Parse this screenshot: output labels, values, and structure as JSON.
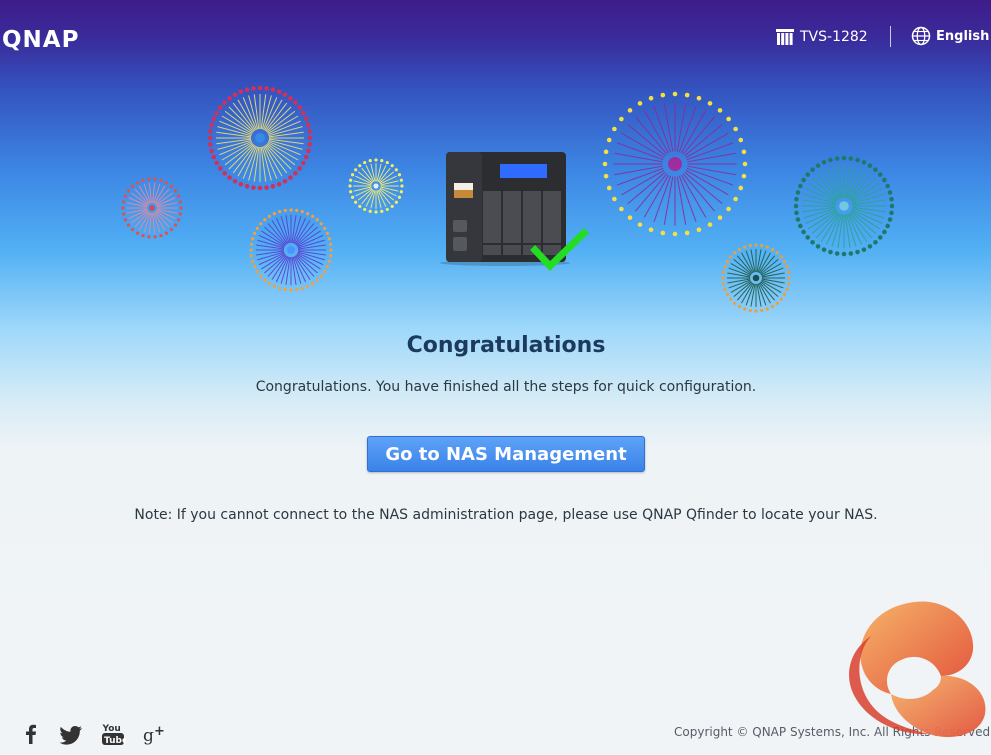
{
  "header": {
    "logo_text": "QNAP",
    "device_name": "TVS-1282",
    "language": "English"
  },
  "main": {
    "title": "Congratulations",
    "subtitle": "Congratulations. You have finished all the steps for quick configuration.",
    "button_label": "Go to NAS Management",
    "note": "Note: If you cannot connect to the NAS administration page, please use QNAP Qfinder to locate your NAS."
  },
  "footer": {
    "social_icons": [
      "facebook-icon",
      "twitter-icon",
      "youtube-icon",
      "google-plus-icon"
    ],
    "copyright": "Copyright © QNAP Systems, Inc. All Rights Reserved."
  },
  "colors": {
    "header_top": "#3e1c8a",
    "accent_button": "#3a82ea",
    "title": "#1c3b5c",
    "checkmark": "#22dd22"
  }
}
